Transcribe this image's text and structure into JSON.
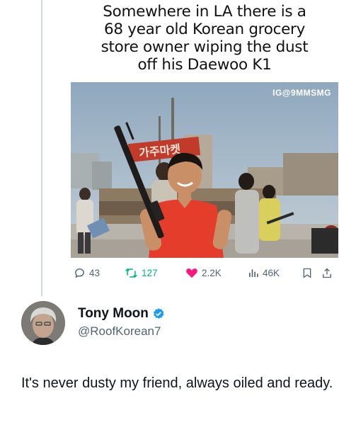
{
  "quoted_post": {
    "meme_caption": "Somewhere in LA there is a\n68 year old Korean grocery\nstore owner wiping the dust\noff his Daewoo K1",
    "photo_watermark": "IG@9MMSMG",
    "photo_sign_text": "가주마켓"
  },
  "actions": {
    "replies": "43",
    "reposts": "127",
    "likes": "2.2K",
    "views": "46K",
    "like_color": "#f91880"
  },
  "reply": {
    "display_name": "Tony Moon",
    "handle": "@RoofKorean7",
    "verified_color": "#1d9bf0",
    "text": "It's never dusty my friend, always oiled and ready."
  }
}
